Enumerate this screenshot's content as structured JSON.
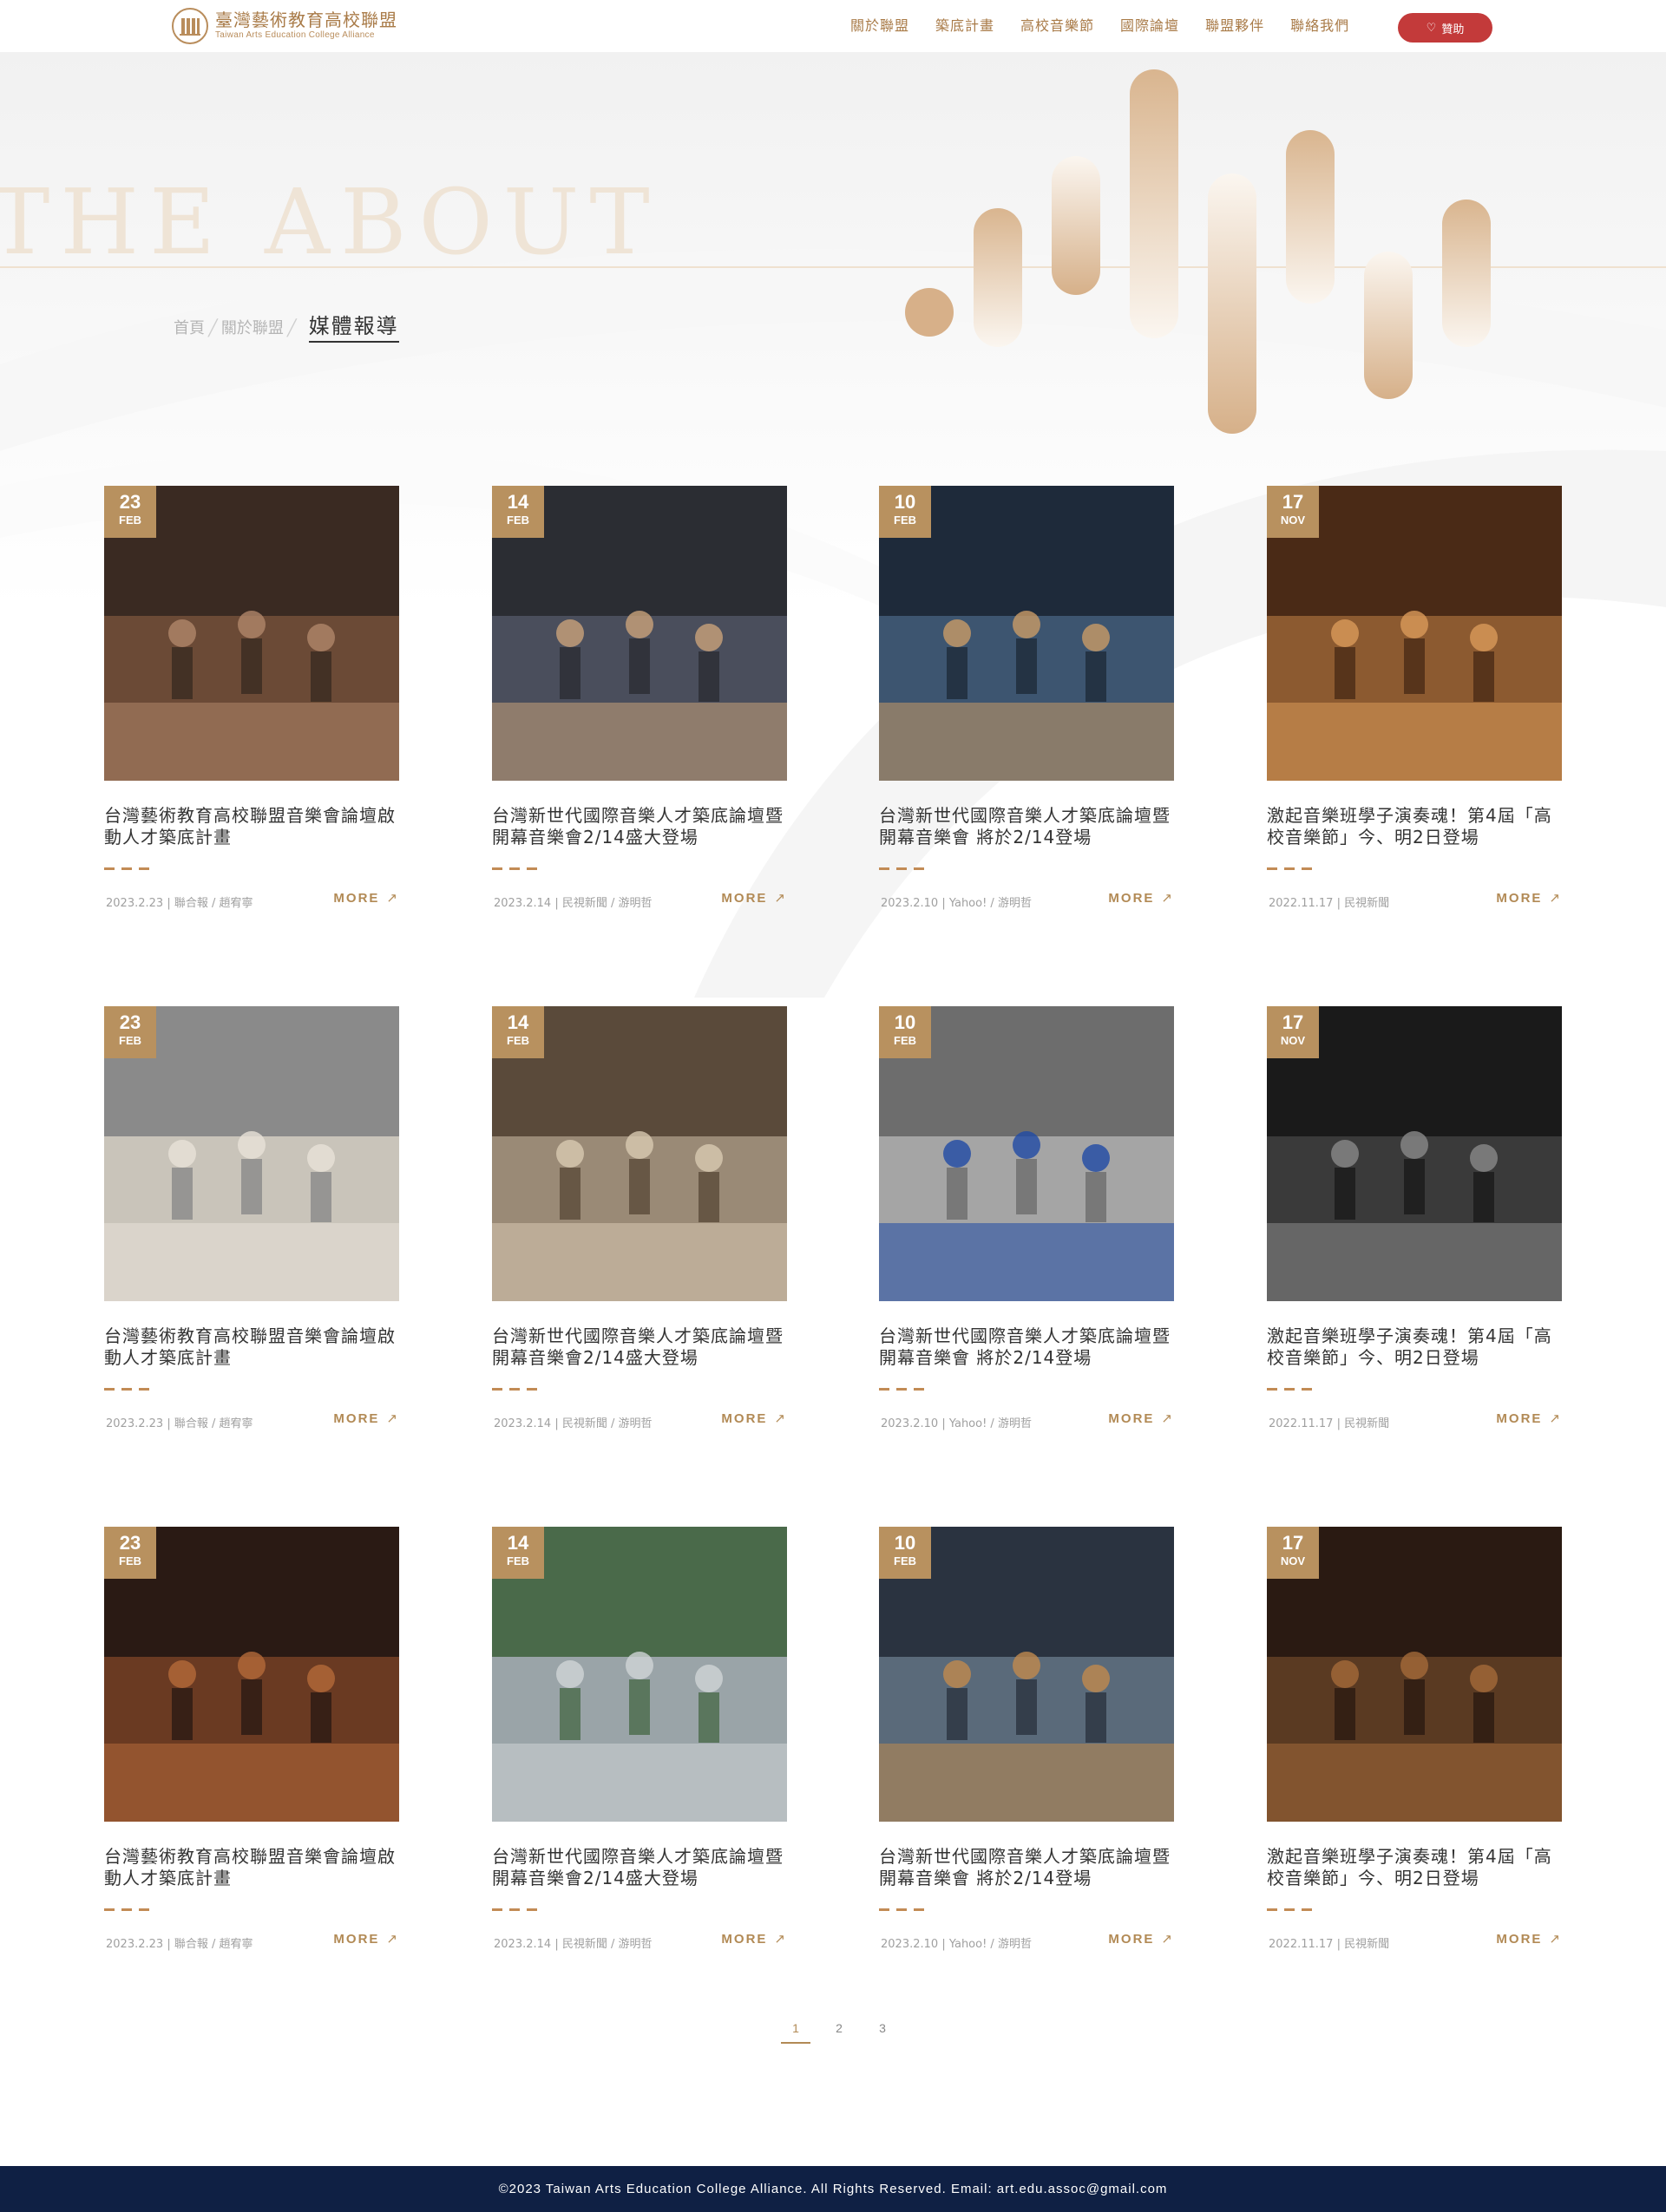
{
  "brand": {
    "name_zh": "臺灣藝術教育高校聯盟",
    "name_en": "Taiwan Arts Education College Alliance"
  },
  "nav": {
    "items": [
      "關於聯盟",
      "築底計畫",
      "高校音樂節",
      "國際論壇",
      "聯盟夥伴",
      "聯絡我們"
    ],
    "donate_label": "贊助",
    "donate_icon": "heart-icon"
  },
  "hero": {
    "title": "THE ABOUT"
  },
  "breadcrumb": {
    "items": [
      "首頁",
      "關於聯盟"
    ],
    "separator": "╱",
    "current": "媒體報導"
  },
  "colors": {
    "accent_gold": "#b8915f",
    "donate_red": "#c33a3a",
    "footer_navy": "#0f2044"
  },
  "articles": [
    {
      "day": "23",
      "month": "FEB",
      "title": "台灣藝術教育高校聯盟音樂會論壇啟動人才築底計畫",
      "date": "2023.2.23",
      "source": "聯合報 / 趙宥寧",
      "more": "MORE"
    },
    {
      "day": "14",
      "month": "FEB",
      "title": "台灣新世代國際音樂人才築底論壇暨開幕音樂會2/14盛大登場",
      "date": "2023.2.14",
      "source": "民視新聞 / 游明哲",
      "more": "MORE"
    },
    {
      "day": "10",
      "month": "FEB",
      "title": "台灣新世代國際音樂人才築底論壇暨開幕音樂會 將於2/14登場",
      "date": "2023.2.10",
      "source": "Yahoo! / 游明哲",
      "more": "MORE"
    },
    {
      "day": "17",
      "month": "NOV",
      "title": "激起音樂班學子演奏魂！第4屆「高校音樂節」今、明2日登場",
      "date": "2022.11.17",
      "source": "民視新聞",
      "more": "MORE"
    },
    {
      "day": "23",
      "month": "FEB",
      "title": "台灣藝術教育高校聯盟音樂會論壇啟動人才築底計畫",
      "date": "2023.2.23",
      "source": "聯合報 / 趙宥寧",
      "more": "MORE"
    },
    {
      "day": "14",
      "month": "FEB",
      "title": "台灣新世代國際音樂人才築底論壇暨開幕音樂會2/14盛大登場",
      "date": "2023.2.14",
      "source": "民視新聞 / 游明哲",
      "more": "MORE"
    },
    {
      "day": "10",
      "month": "FEB",
      "title": "台灣新世代國際音樂人才築底論壇暨開幕音樂會 將於2/14登場",
      "date": "2023.2.10",
      "source": "Yahoo! / 游明哲",
      "more": "MORE"
    },
    {
      "day": "17",
      "month": "NOV",
      "title": "激起音樂班學子演奏魂！第4屆「高校音樂節」今、明2日登場",
      "date": "2022.11.17",
      "source": "民視新聞",
      "more": "MORE"
    },
    {
      "day": "23",
      "month": "FEB",
      "title": "台灣藝術教育高校聯盟音樂會論壇啟動人才築底計畫",
      "date": "2023.2.23",
      "source": "聯合報 / 趙宥寧",
      "more": "MORE"
    },
    {
      "day": "14",
      "month": "FEB",
      "title": "台灣新世代國際音樂人才築底論壇暨開幕音樂會2/14盛大登場",
      "date": "2023.2.14",
      "source": "民視新聞 / 游明哲",
      "more": "MORE"
    },
    {
      "day": "10",
      "month": "FEB",
      "title": "台灣新世代國際音樂人才築底論壇暨開幕音樂會 將於2/14登場",
      "date": "2023.2.10",
      "source": "Yahoo! / 游明哲",
      "more": "MORE"
    },
    {
      "day": "17",
      "month": "NOV",
      "title": "激起音樂班學子演奏魂！第4屆「高校音樂節」今、明2日登場",
      "date": "2022.11.17",
      "source": "民視新聞",
      "more": "MORE"
    }
  ],
  "pagination": {
    "pages": [
      "1",
      "2",
      "3"
    ],
    "current": "1"
  },
  "footer": {
    "text": "©2023 Taiwan Arts Education College Alliance. All Rights Reserved. Email: art.edu.assoc@gmail.com"
  }
}
